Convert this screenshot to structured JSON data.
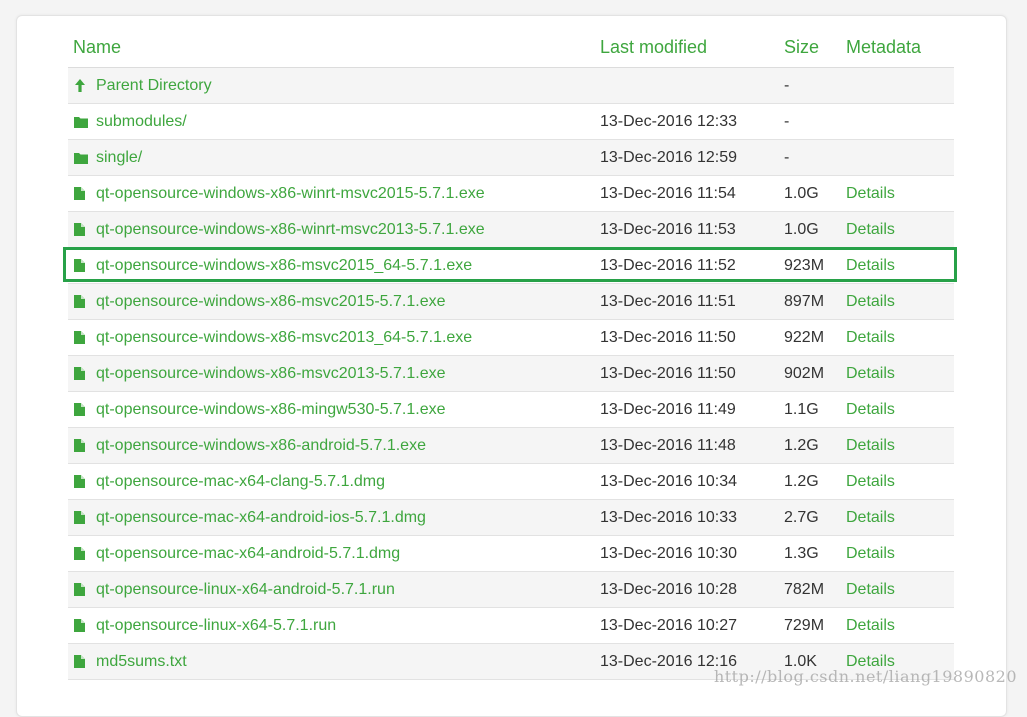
{
  "colors": {
    "link": "#3ea63e",
    "text": "#333333",
    "highlight_border": "#27a148"
  },
  "header": {
    "name": "Name",
    "last_modified": "Last modified",
    "size": "Size",
    "metadata": "Metadata"
  },
  "rows": [
    {
      "icon": "arrow-up-icon",
      "name": "Parent Directory",
      "modified": "",
      "size": "-",
      "meta": ""
    },
    {
      "icon": "folder-icon",
      "name": "submodules/",
      "modified": "13-Dec-2016 12:33",
      "size": "-",
      "meta": ""
    },
    {
      "icon": "folder-icon",
      "name": "single/",
      "modified": "13-Dec-2016 12:59",
      "size": "-",
      "meta": ""
    },
    {
      "icon": "file-icon",
      "name": "qt-opensource-windows-x86-winrt-msvc2015-5.7.1.exe",
      "modified": "13-Dec-2016 11:54",
      "size": "1.0G",
      "meta": "Details"
    },
    {
      "icon": "file-icon",
      "name": "qt-opensource-windows-x86-winrt-msvc2013-5.7.1.exe",
      "modified": "13-Dec-2016 11:53",
      "size": "1.0G",
      "meta": "Details"
    },
    {
      "icon": "file-icon",
      "name": "qt-opensource-windows-x86-msvc2015_64-5.7.1.exe",
      "modified": "13-Dec-2016 11:52",
      "size": "923M",
      "meta": "Details",
      "highlighted": true
    },
    {
      "icon": "file-icon",
      "name": "qt-opensource-windows-x86-msvc2015-5.7.1.exe",
      "modified": "13-Dec-2016 11:51",
      "size": "897M",
      "meta": "Details"
    },
    {
      "icon": "file-icon",
      "name": "qt-opensource-windows-x86-msvc2013_64-5.7.1.exe",
      "modified": "13-Dec-2016 11:50",
      "size": "922M",
      "meta": "Details"
    },
    {
      "icon": "file-icon",
      "name": "qt-opensource-windows-x86-msvc2013-5.7.1.exe",
      "modified": "13-Dec-2016 11:50",
      "size": "902M",
      "meta": "Details"
    },
    {
      "icon": "file-icon",
      "name": "qt-opensource-windows-x86-mingw530-5.7.1.exe",
      "modified": "13-Dec-2016 11:49",
      "size": "1.1G",
      "meta": "Details"
    },
    {
      "icon": "file-icon",
      "name": "qt-opensource-windows-x86-android-5.7.1.exe",
      "modified": "13-Dec-2016 11:48",
      "size": "1.2G",
      "meta": "Details"
    },
    {
      "icon": "file-icon",
      "name": "qt-opensource-mac-x64-clang-5.7.1.dmg",
      "modified": "13-Dec-2016 10:34",
      "size": "1.2G",
      "meta": "Details"
    },
    {
      "icon": "file-icon",
      "name": "qt-opensource-mac-x64-android-ios-5.7.1.dmg",
      "modified": "13-Dec-2016 10:33",
      "size": "2.7G",
      "meta": "Details"
    },
    {
      "icon": "file-icon",
      "name": "qt-opensource-mac-x64-android-5.7.1.dmg",
      "modified": "13-Dec-2016 10:30",
      "size": "1.3G",
      "meta": "Details"
    },
    {
      "icon": "file-icon",
      "name": "qt-opensource-linux-x64-android-5.7.1.run",
      "modified": "13-Dec-2016 10:28",
      "size": "782M",
      "meta": "Details"
    },
    {
      "icon": "file-icon",
      "name": "qt-opensource-linux-x64-5.7.1.run",
      "modified": "13-Dec-2016 10:27",
      "size": "729M",
      "meta": "Details"
    },
    {
      "icon": "file-icon",
      "name": "md5sums.txt",
      "modified": "13-Dec-2016 12:16",
      "size": "1.0K",
      "meta": "Details"
    }
  ],
  "watermark": "http://blog.csdn.net/liang19890820"
}
